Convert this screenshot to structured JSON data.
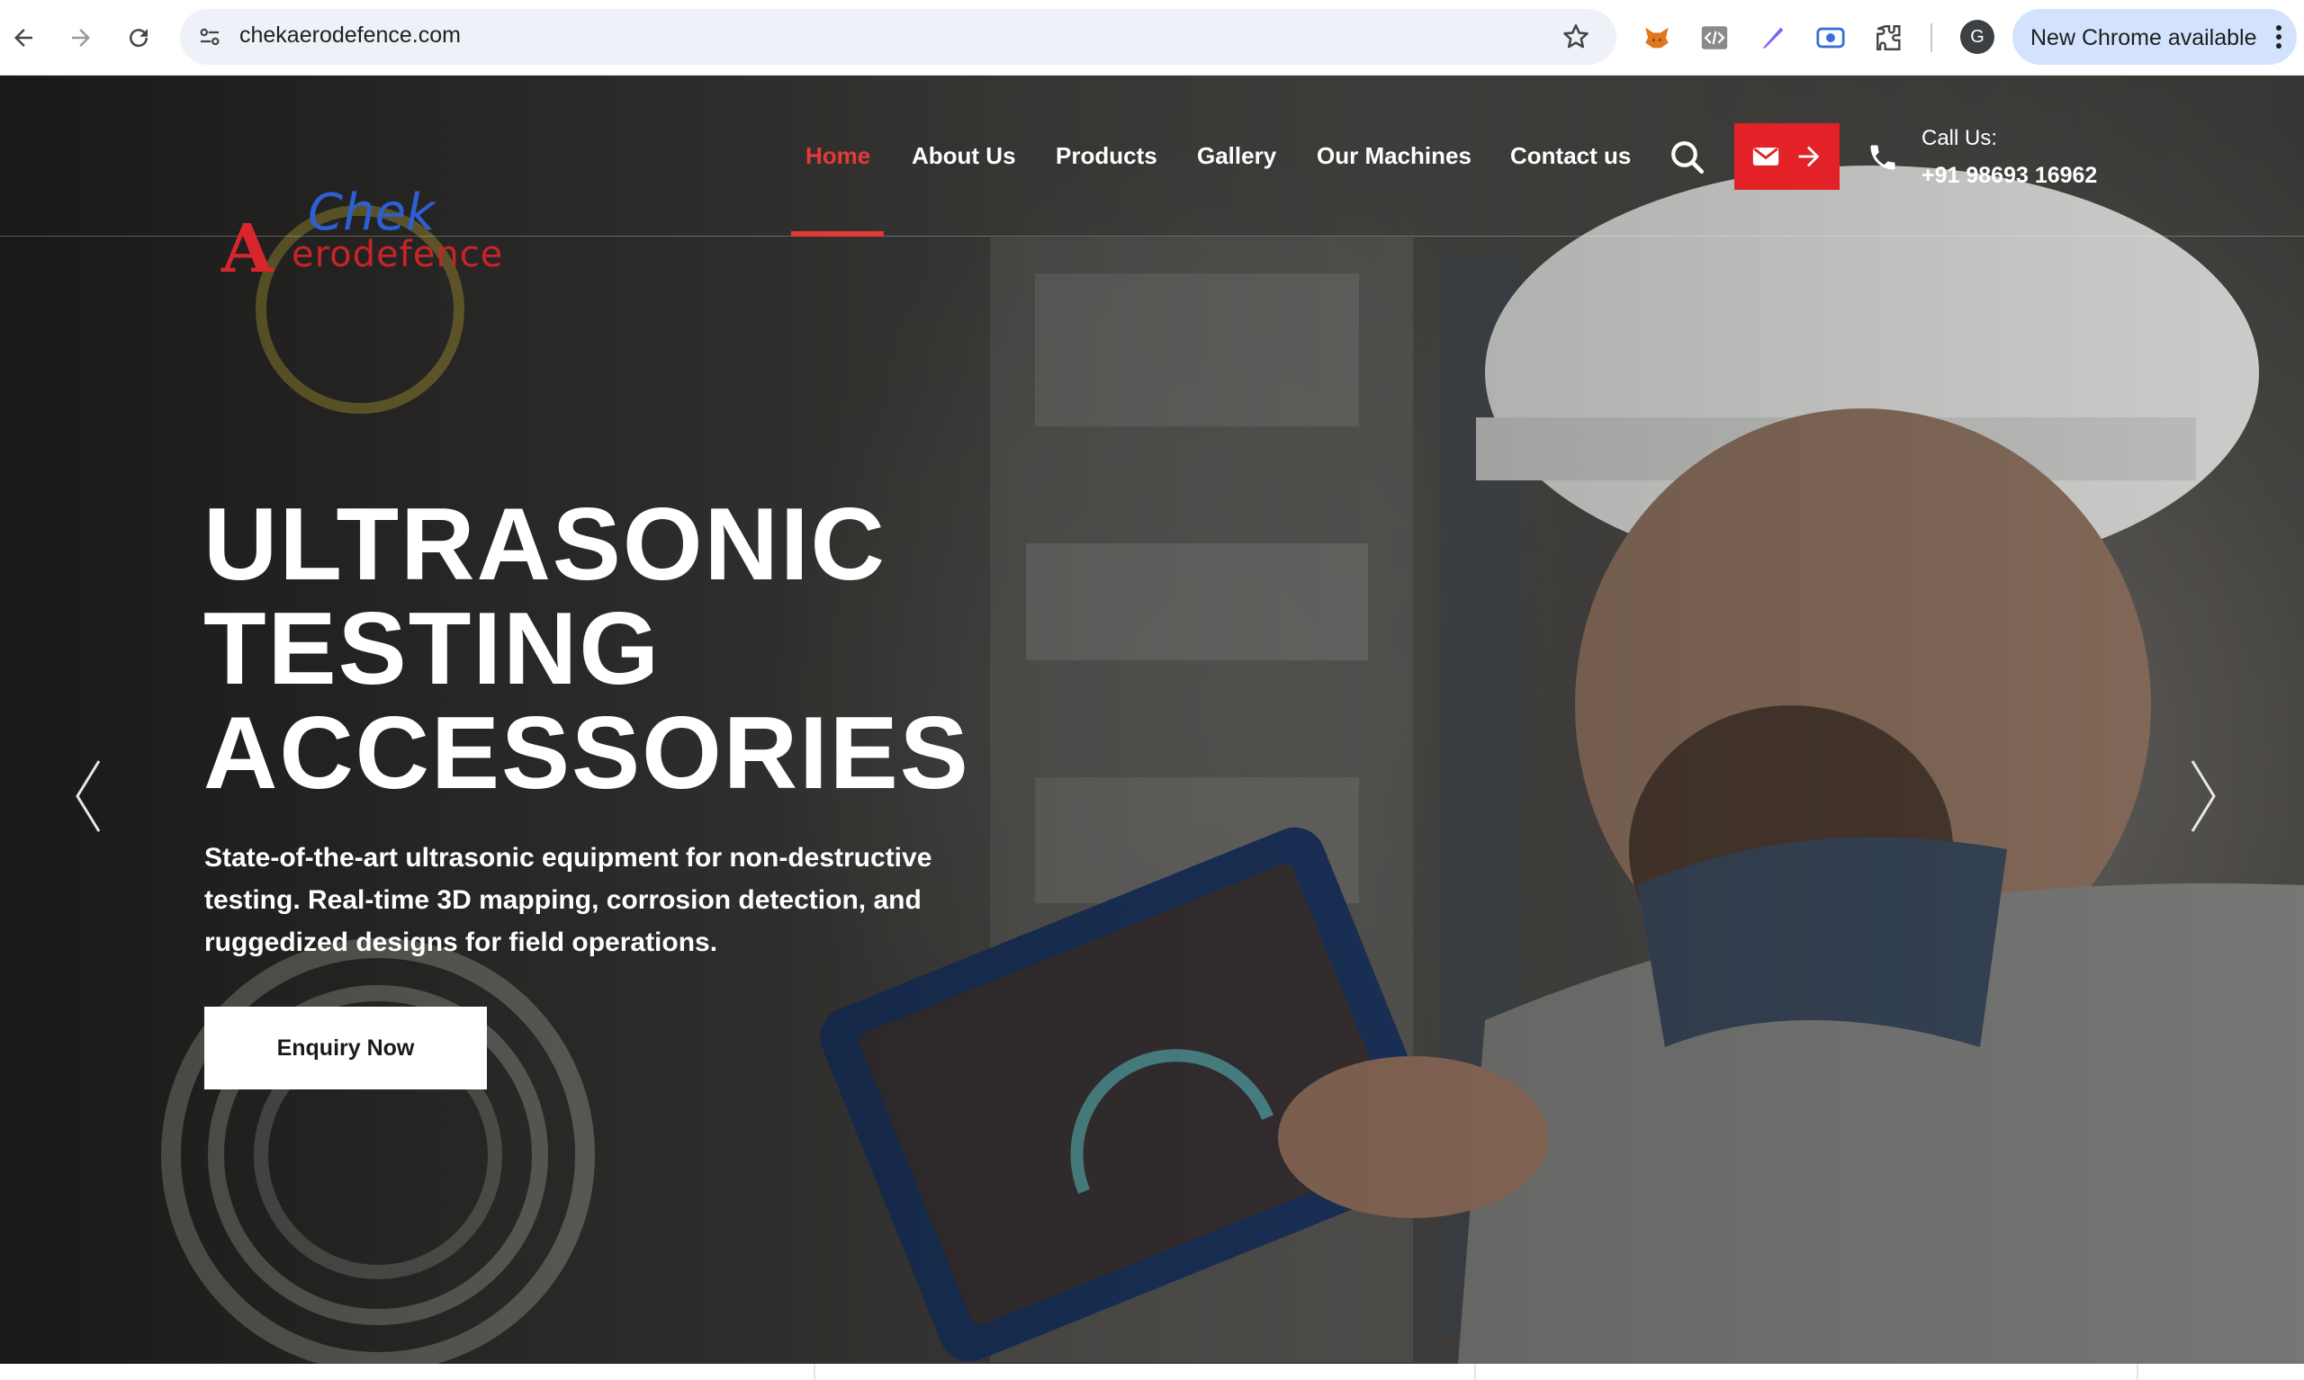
{
  "browser": {
    "url": "chekaerodefence.com",
    "profile_initial": "G",
    "update_label": "New Chrome available",
    "extensions": [
      "fox-extension-icon",
      "code-extension-icon",
      "pen-extension-icon",
      "screen-record-extension-icon",
      "puzzle-extensions-icon"
    ]
  },
  "site": {
    "logo": {
      "chek": "Chek",
      "a": "A",
      "rest": "erodefence"
    },
    "nav": [
      {
        "label": "Home",
        "active": true
      },
      {
        "label": "About Us",
        "active": false
      },
      {
        "label": "Products",
        "active": false
      },
      {
        "label": "Gallery",
        "active": false
      },
      {
        "label": "Our Machines",
        "active": false
      },
      {
        "label": "Contact us",
        "active": false
      }
    ],
    "call_label": "Call Us:",
    "call_number": "+91 98693 16962",
    "accent_color": "#e22227"
  },
  "hero": {
    "title_lines": [
      "ULTRASONIC",
      "TESTING",
      "ACCESSORIES"
    ],
    "description": "State-of-the-art ultrasonic equipment for non-destructive testing. Real-time 3D mapping, corrosion detection, and ruggedized designs for field operations.",
    "button_label": "Enquiry Now"
  }
}
